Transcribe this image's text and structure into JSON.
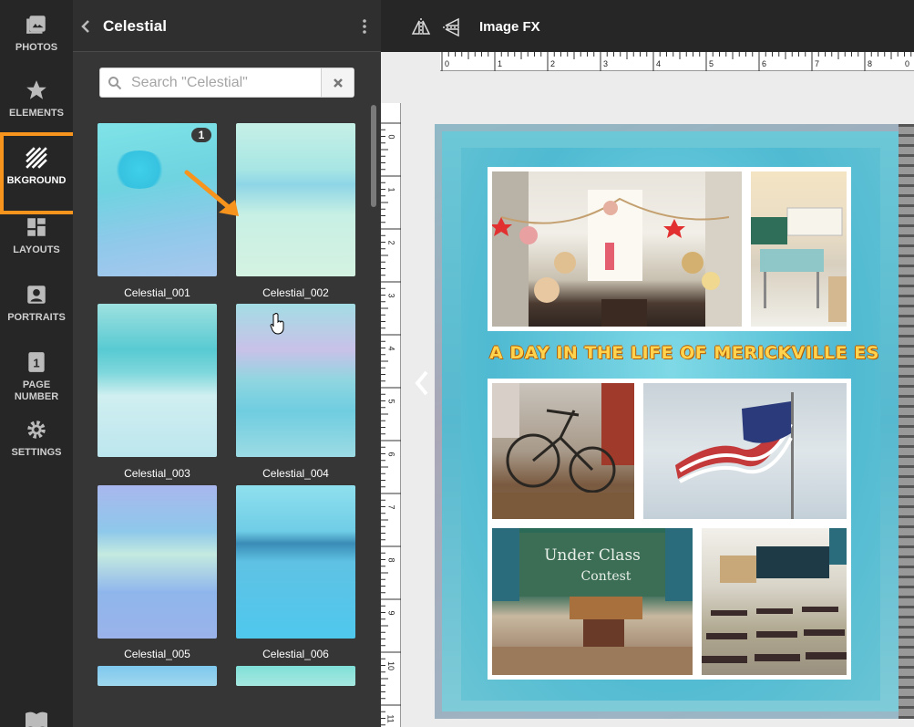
{
  "rail": {
    "items": [
      {
        "label": "PHOTOS",
        "icon": "photos-icon"
      },
      {
        "label": "ELEMENTS",
        "icon": "star-icon"
      },
      {
        "label": "BKGROUND",
        "icon": "background-icon"
      },
      {
        "label": "LAYOUTS",
        "icon": "layouts-icon"
      },
      {
        "label": "PORTRAITS",
        "icon": "portrait-icon"
      },
      {
        "label": "PAGE\nNUMBER",
        "icon": "page-number-icon",
        "badge": "1"
      },
      {
        "label": "SETTINGS",
        "icon": "gear-icon"
      }
    ],
    "active": "BKGROUND",
    "highlight_color": "#f7941d"
  },
  "panel": {
    "title": "Celestial",
    "search": {
      "placeholder": "Search \"Celestial\"",
      "value": ""
    },
    "thumbnails": [
      {
        "label": "Celestial_001",
        "badge": "1"
      },
      {
        "label": "Celestial_002"
      },
      {
        "label": "Celestial_003"
      },
      {
        "label": "Celestial_004"
      },
      {
        "label": "Celestial_005"
      },
      {
        "label": "Celestial_006"
      }
    ]
  },
  "toolbar": {
    "image_fx_label": "Image FX",
    "tools": [
      "flip-horizontal-icon",
      "flip-vertical-icon"
    ]
  },
  "ruler": {
    "top": [
      "0",
      "1",
      "2",
      "3",
      "4",
      "5",
      "6",
      "7",
      "8",
      "0"
    ],
    "left": [
      "0",
      "1",
      "2",
      "3",
      "4",
      "5",
      "6",
      "7",
      "8",
      "9",
      "10",
      "11"
    ]
  },
  "page": {
    "headline": "A DAY IN THE LIFE OF MERICKVILLE ES",
    "photos": [
      {
        "subject": "stairwell with garland"
      },
      {
        "subject": "classroom desk"
      },
      {
        "subject": "bicycle"
      },
      {
        "subject": "american flag"
      },
      {
        "subject": "chalkboard classroom"
      },
      {
        "subject": "empty classroom desks"
      }
    ],
    "chalkboard_text": "Under Class Contest"
  },
  "colors": {
    "rail_bg": "#262626",
    "panel_bg": "#363636",
    "canvas_bg": "#ececec",
    "accent": "#f7941d",
    "headline": "#ffd34d"
  }
}
